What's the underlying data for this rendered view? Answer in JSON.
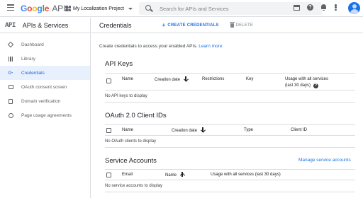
{
  "topbar": {
    "logo": {
      "g": "G",
      "o1": "o",
      "o2": "o",
      "g2": "g",
      "l": "l",
      "e": "e",
      "apis": "APIs"
    },
    "project_name": "My Localization Project",
    "search_placeholder": "Search for APIs and Services",
    "help_glyph": "?"
  },
  "sidebar": {
    "badge": "API",
    "title": "APIs & Services",
    "items": [
      {
        "label": "Dashboard",
        "icon": "dashboard-icon"
      },
      {
        "label": "Library",
        "icon": "library-icon"
      },
      {
        "label": "Credentials",
        "icon": "key-icon",
        "active": true
      },
      {
        "label": "OAuth consent screen",
        "icon": "consent-icon"
      },
      {
        "label": "Domain verification",
        "icon": "checkbox-icon"
      },
      {
        "label": "Page usage agreements",
        "icon": "settings-icon"
      }
    ],
    "key_glyph": "o-"
  },
  "main": {
    "title": "Credentials",
    "create_label": "CREATE CREDENTIALS",
    "create_glyph": "+",
    "delete_label": "DELETE",
    "intro": "Create credentials to access your enabled APIs.",
    "learn_more": "Learn more",
    "api_keys": {
      "title": "API Keys",
      "columns": [
        "Name",
        "Creation date",
        "Restrictions",
        "Key",
        "Usage with all services",
        "(last 30 days)"
      ],
      "empty": "No API keys to display"
    },
    "oauth": {
      "title": "OAuth 2.0 Client IDs",
      "columns": [
        "Name",
        "Creation date",
        "Type",
        "Client ID"
      ],
      "empty": "No OAuth clients to display"
    },
    "service_accounts": {
      "title": "Service Accounts",
      "manage_link": "Manage service accounts",
      "columns": [
        "Email",
        "Name",
        "Usage with all services (last 30 days)"
      ],
      "empty": "No service accounts to display"
    }
  },
  "colors": {
    "accent": "#1a73e8",
    "active_bg": "#e8f0fe",
    "active_text": "#1967d2",
    "border": "#dadce0"
  }
}
